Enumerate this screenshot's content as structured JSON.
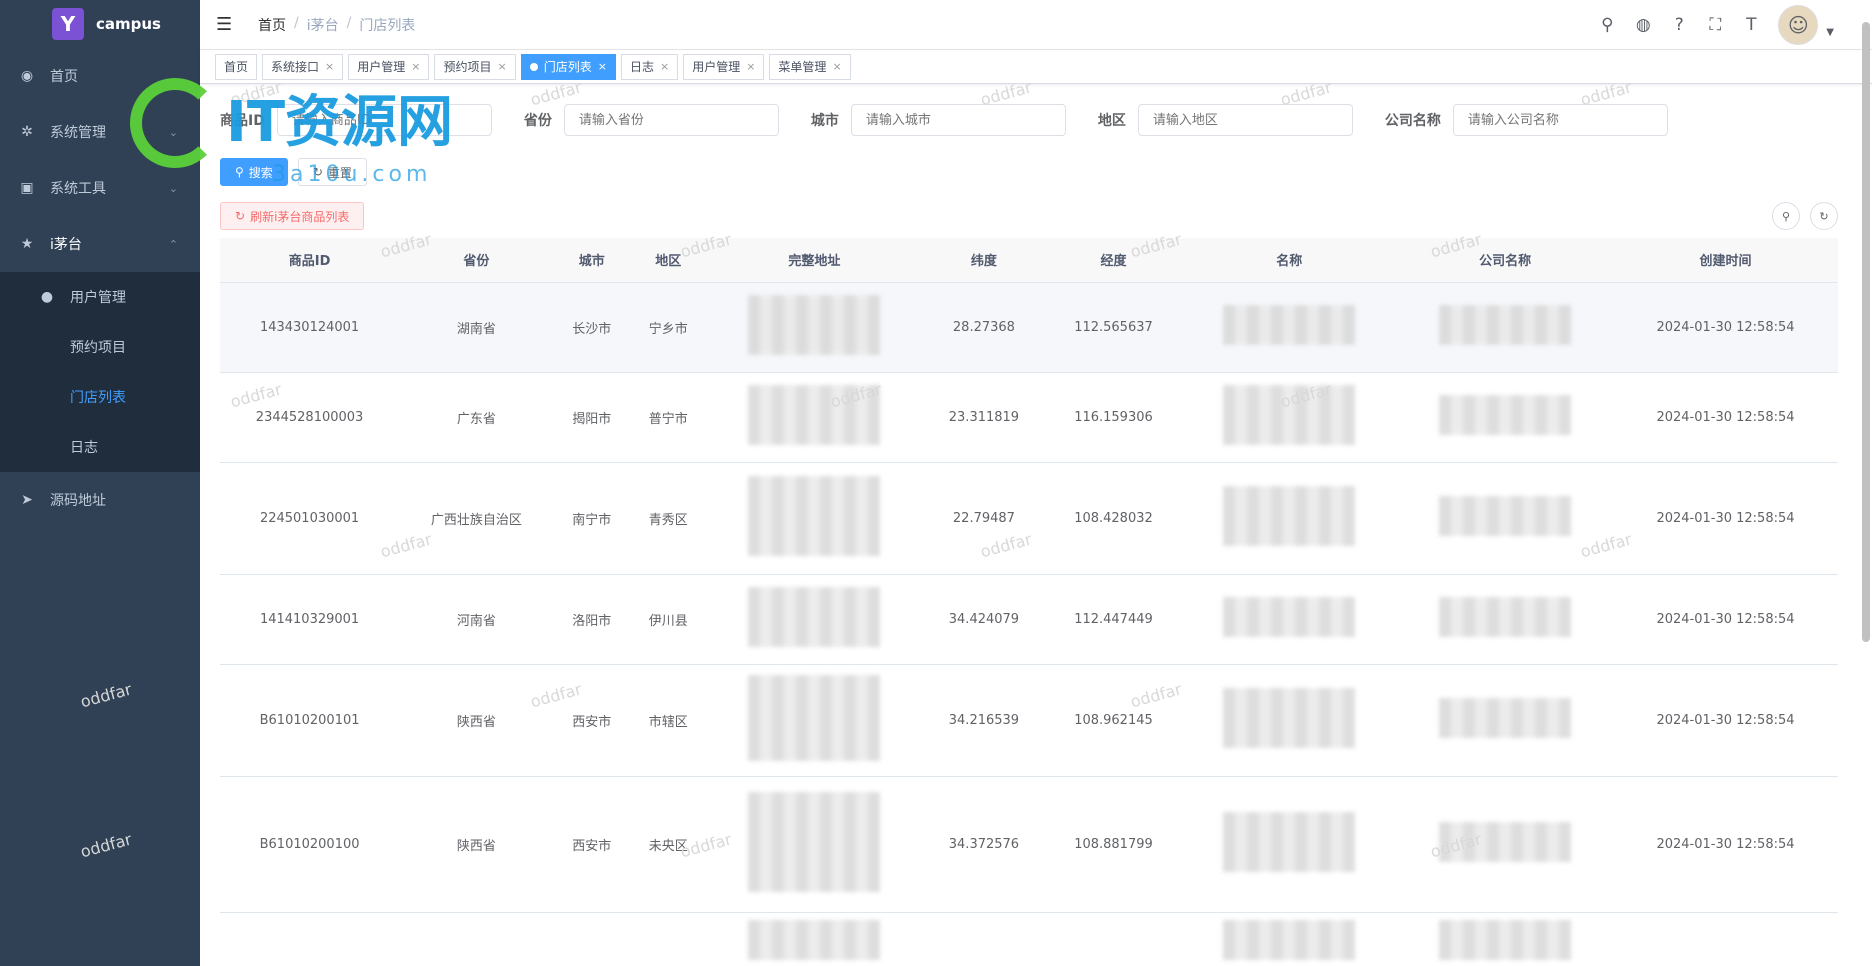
{
  "app": {
    "title": "campus",
    "logo_letter": "Y"
  },
  "sidebar": {
    "items": [
      {
        "label": "首页",
        "icon": "dashboard-icon"
      },
      {
        "label": "系统管理",
        "icon": "gear-icon"
      },
      {
        "label": "系统工具",
        "icon": "toolbox-icon"
      },
      {
        "label": "i茅台",
        "icon": "star-icon"
      }
    ],
    "sub": [
      {
        "label": "用户管理",
        "icon": "user-icon"
      },
      {
        "label": "预约项目"
      },
      {
        "label": "门店列表"
      },
      {
        "label": "日志"
      }
    ],
    "source": {
      "label": "源码地址",
      "icon": "send-icon"
    }
  },
  "breadcrumb": {
    "home": "首页",
    "mid": "i茅台",
    "current": "门店列表"
  },
  "tags": [
    {
      "label": "首页"
    },
    {
      "label": "系统接口"
    },
    {
      "label": "用户管理"
    },
    {
      "label": "预约项目"
    },
    {
      "label": "门店列表"
    },
    {
      "label": "日志"
    },
    {
      "label": "用户管理"
    },
    {
      "label": "菜单管理"
    }
  ],
  "search": {
    "labels": {
      "province": "省份",
      "city": "城市",
      "district": "地区",
      "company": "公司名称",
      "id": "商品ID"
    },
    "placeholders": {
      "province": "请输入省份",
      "city": "请输入城市",
      "district": "请输入地区",
      "company": "请输入公司名称",
      "id": "请输入商品ID"
    },
    "search_btn": "搜索",
    "reset_btn": "重置",
    "refresh_btn": "刷新i茅台商品列表"
  },
  "table": {
    "headers": [
      "商品ID",
      "省份",
      "城市",
      "地区",
      "完整地址",
      "纬度",
      "经度",
      "名称",
      "公司名称",
      "创建时间"
    ],
    "rows": [
      {
        "id": "143430124001",
        "province": "湖南省",
        "city": "长沙市",
        "district": "宁乡市",
        "lat": "28.27368",
        "lng": "112.565637",
        "time": "2024-01-30 12:58:54"
      },
      {
        "id": "2344528100003",
        "province": "广东省",
        "city": "揭阳市",
        "district": "普宁市",
        "lat": "23.311819",
        "lng": "116.159306",
        "time": "2024-01-30 12:58:54"
      },
      {
        "id": "224501030001",
        "province": "广西壮族自治区",
        "city": "南宁市",
        "district": "青秀区",
        "lat": "22.79487",
        "lng": "108.428032",
        "time": "2024-01-30 12:58:54"
      },
      {
        "id": "141410329001",
        "province": "河南省",
        "city": "洛阳市",
        "district": "伊川县",
        "lat": "34.424079",
        "lng": "112.447449",
        "time": "2024-01-30 12:58:54"
      },
      {
        "id": "B61010200101",
        "province": "陕西省",
        "city": "西安市",
        "district": "市辖区",
        "lat": "34.216539",
        "lng": "108.962145",
        "time": "2024-01-30 12:58:54"
      },
      {
        "id": "B61010200100",
        "province": "陕西省",
        "city": "西安市",
        "district": "未央区",
        "lat": "34.372576",
        "lng": "108.881799",
        "time": "2024-01-30 12:58:54"
      }
    ]
  },
  "overlay": {
    "brand": "IT资源网",
    "sub": "3a10u.com",
    "watermark": "oddfar"
  }
}
